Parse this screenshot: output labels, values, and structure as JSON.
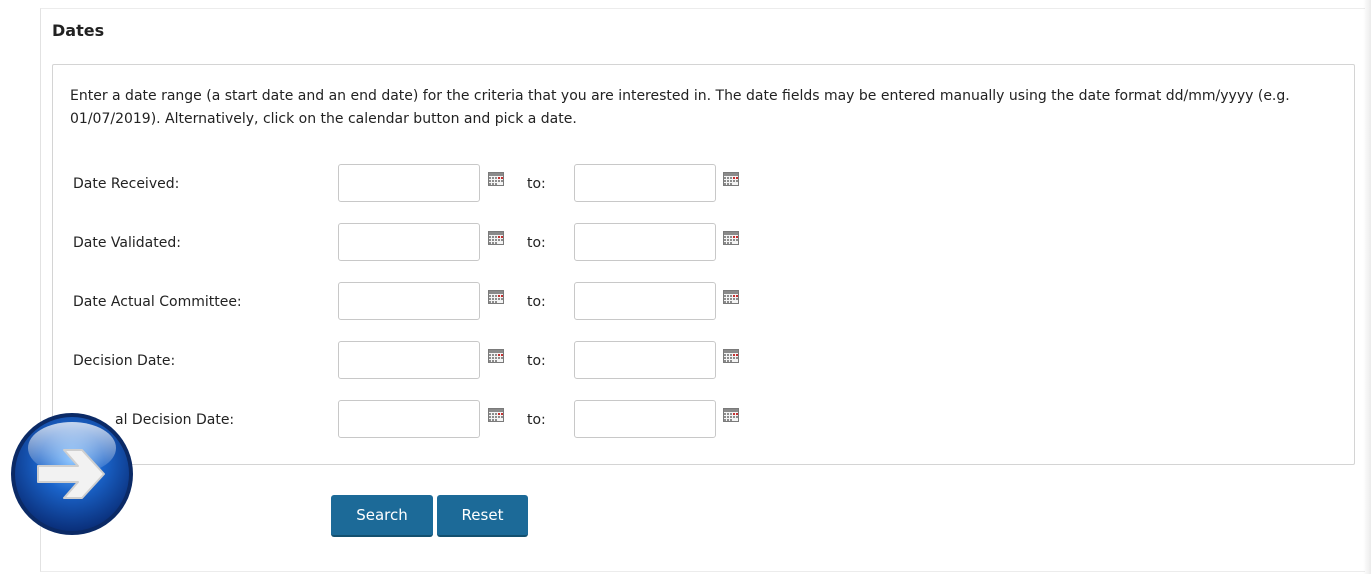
{
  "section": {
    "title": "Dates",
    "intro": "Enter a date range (a start date and an end date) for the criteria that you are interested in. The date fields may be entered manually using the date format dd/mm/yyyy (e.g. 01/07/2019). Alternatively, click on the calendar button and pick a date."
  },
  "rows": [
    {
      "label": "Date Received:",
      "to": "to:"
    },
    {
      "label": "Date Validated:",
      "to": "to:"
    },
    {
      "label": "Date Actual Committee:",
      "to": "to:"
    },
    {
      "label": "Decision Date:",
      "to": "to:"
    },
    {
      "label": "al Decision Date:",
      "to": "to:"
    }
  ],
  "buttons": {
    "search": "Search",
    "reset": "Reset"
  },
  "colors": {
    "button": "#1c6a98",
    "overlay_arrow": "#1a63c9"
  },
  "icons": {
    "calendar": "calendar-icon",
    "overlay": "arrow-right-icon"
  }
}
